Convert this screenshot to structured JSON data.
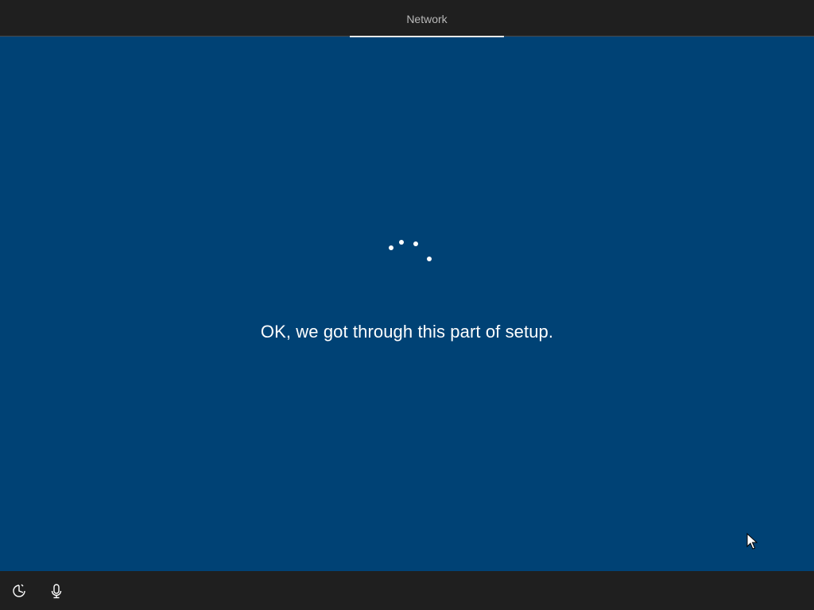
{
  "header": {
    "tab_label": "Network"
  },
  "main": {
    "message": "OK, we got through this part of setup."
  },
  "footer": {
    "icons": [
      "ease-of-access-icon",
      "microphone-icon"
    ]
  },
  "colors": {
    "background": "#004275",
    "bar": "#1f1f1f",
    "text": "#ffffff"
  }
}
